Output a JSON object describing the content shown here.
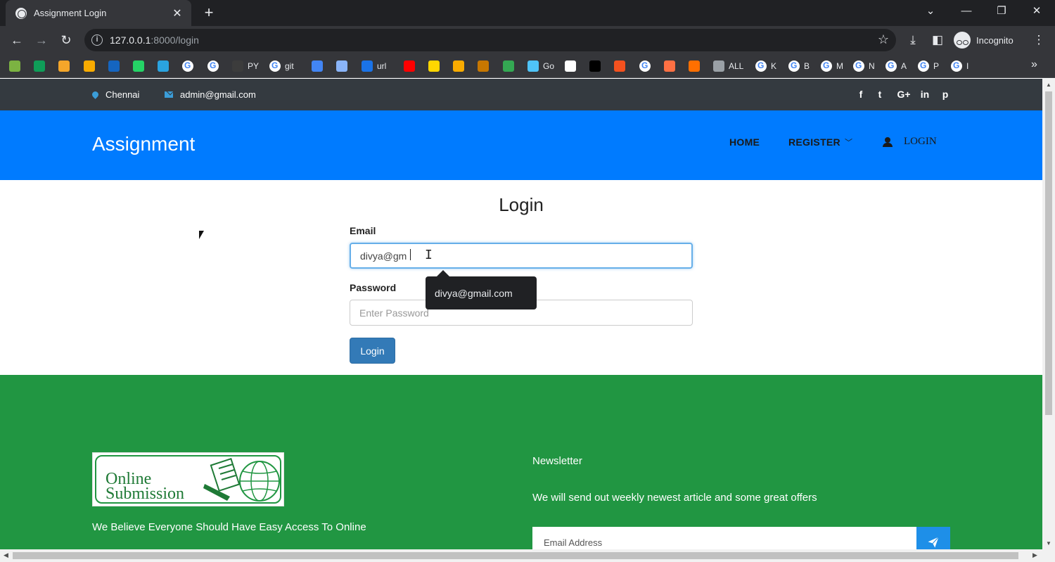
{
  "browser": {
    "tab_title": "Assignment Login",
    "tab_close": "✕",
    "new_tab": "+",
    "url_host": "127.0.0.1",
    "url_rest": ":8000/login",
    "incognito_label": "Incognito",
    "bookmarks": [
      {
        "label": "",
        "color": "#7cb342"
      },
      {
        "label": "",
        "color": "#0f9d58"
      },
      {
        "label": "",
        "color": "#f4a62a"
      },
      {
        "label": "",
        "color": "#f9ab00"
      },
      {
        "label": "",
        "color": "#1565c0"
      },
      {
        "label": "",
        "color": "#25d366"
      },
      {
        "label": "",
        "color": "#2aa3e0"
      },
      {
        "label": "",
        "color": "google"
      },
      {
        "label": "",
        "color": "google"
      },
      {
        "label": "PY",
        "color": "#3c3c3c"
      },
      {
        "label": "git",
        "color": "google"
      },
      {
        "label": "",
        "color": "#4285f4"
      },
      {
        "label": "",
        "color": "#8ab4f8"
      },
      {
        "label": "url",
        "color": "#1a73e8"
      },
      {
        "label": "",
        "color": "#ff0000"
      },
      {
        "label": "",
        "color": "#ffd600"
      },
      {
        "label": "",
        "color": "#f9ab00"
      },
      {
        "label": "",
        "color": "#c77700"
      },
      {
        "label": "",
        "color": "#34a853"
      },
      {
        "label": "Go",
        "color": "#4fc3f7"
      },
      {
        "label": "",
        "color": "#ffffff"
      },
      {
        "label": "",
        "color": "#000000"
      },
      {
        "label": "",
        "color": "#f4511e"
      },
      {
        "label": "",
        "color": "google"
      },
      {
        "label": "",
        "color": "#ff7043"
      },
      {
        "label": "",
        "color": "#ff6f00"
      },
      {
        "label": "ALL",
        "color": "#9aa0a6"
      },
      {
        "label": "K",
        "color": "google"
      },
      {
        "label": "B",
        "color": "google"
      },
      {
        "label": "M",
        "color": "google"
      },
      {
        "label": "N",
        "color": "google"
      },
      {
        "label": "A",
        "color": "google"
      },
      {
        "label": "P",
        "color": "google"
      },
      {
        "label": "I",
        "color": "google"
      }
    ]
  },
  "topbar": {
    "location": "Chennai",
    "email": "admin@gmail.com",
    "social": [
      "f",
      "t",
      "G+",
      "in",
      "p"
    ]
  },
  "navbar": {
    "brand": "Assignment",
    "home": "HOME",
    "register": "REGISTER",
    "login": "LOGIN"
  },
  "login": {
    "title": "Login",
    "email_label": "Email",
    "email_value": "divya@gm",
    "password_label": "Password",
    "password_placeholder": "Enter Password",
    "button": "Login",
    "autofill_suggestion": "divya@gmail.com"
  },
  "footer": {
    "logo_text": "Online\nSubmission",
    "tagline": "We Believe Everyone Should Have Easy Access To Online",
    "newsletter_title": "Newsletter",
    "newsletter_desc": "We will send out weekly newest article and some great offers",
    "newsletter_placeholder": "Email Address"
  },
  "colors": {
    "topbar": "#343a40",
    "navbar": "#007bff",
    "footer": "#219642",
    "login_button": "#337ab7",
    "send_button": "#1e8fe8"
  }
}
